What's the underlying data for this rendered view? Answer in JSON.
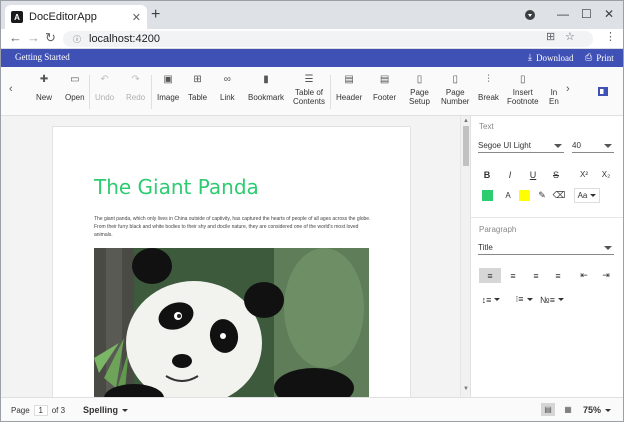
{
  "browser": {
    "tab_title": "DocEditorApp",
    "tab_favicon": "A",
    "url": "localhost:4200"
  },
  "appbar": {
    "getting_started": "Getting Started",
    "download": "Download",
    "print": "Print"
  },
  "ribbon": {
    "new": "New",
    "open": "Open",
    "undo": "Undo",
    "redo": "Redo",
    "image": "Image",
    "table": "Table",
    "link": "Link",
    "bookmark": "Bookmark",
    "toc_line1": "Table of",
    "toc_line2": "Contents",
    "header": "Header",
    "footer": "Footer",
    "page_setup_line1": "Page",
    "page_setup_line2": "Setup",
    "page_number_line1": "Page",
    "page_number_line2": "Number",
    "break": "Break",
    "insert_footnote_line1": "Insert",
    "insert_footnote_line2": "Footnote",
    "insert_endnote_line1": "In",
    "insert_endnote_line2": "En"
  },
  "document": {
    "title": "The Giant Panda",
    "paragraph": "The giant panda, which only lives in China outside of captivity, has captured the hearts of people of all ages across the globe. From their furry black and white bodies to their shy and docile nature, they are considered one of the world's most loved animals."
  },
  "pane": {
    "text_label": "Text",
    "font_family": "Segoe UI Light",
    "font_size": "40",
    "bold": "B",
    "italic": "I",
    "underline": "U",
    "strikethrough": "S",
    "superscript": "X²",
    "subscript": "X₂",
    "font_color_letter": "A",
    "change_case": "Aa",
    "paragraph_label": "Paragraph",
    "style": "Title",
    "font_color": "#2ecc71",
    "highlight_color": "#ffff00"
  },
  "status": {
    "page_label": "Page",
    "current_page": "1",
    "of_pages": "of 3",
    "spelling": "Spelling",
    "zoom": "75%"
  }
}
